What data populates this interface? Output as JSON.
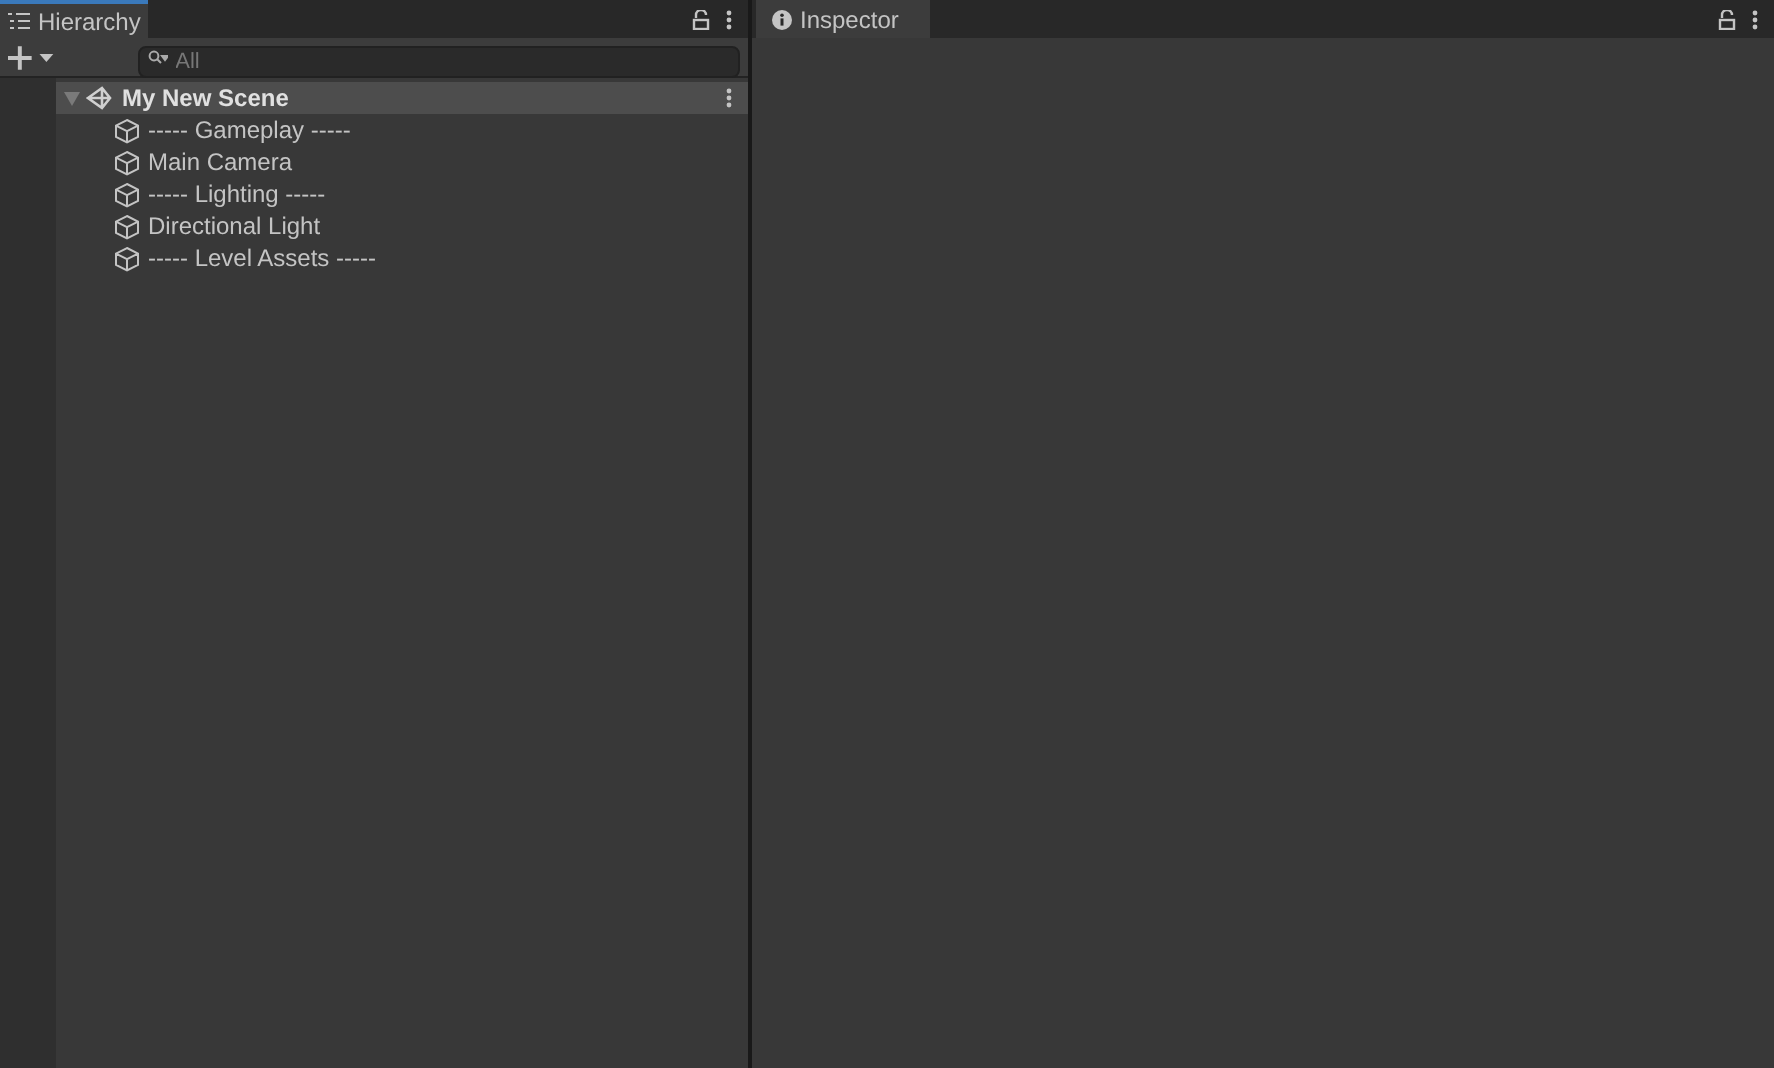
{
  "hierarchy": {
    "tab": {
      "title": "Hierarchy",
      "selected": true
    },
    "search": {
      "placeholder": "All"
    },
    "scene": {
      "name": "My New Scene",
      "expanded": true,
      "children": [
        {
          "name": "----- Gameplay -----"
        },
        {
          "name": "Main Camera"
        },
        {
          "name": "----- Lighting -----"
        },
        {
          "name": "Directional Light"
        },
        {
          "name": "----- Level Assets -----"
        }
      ]
    }
  },
  "inspector": {
    "tab": {
      "title": "Inspector",
      "selected": true
    }
  }
}
